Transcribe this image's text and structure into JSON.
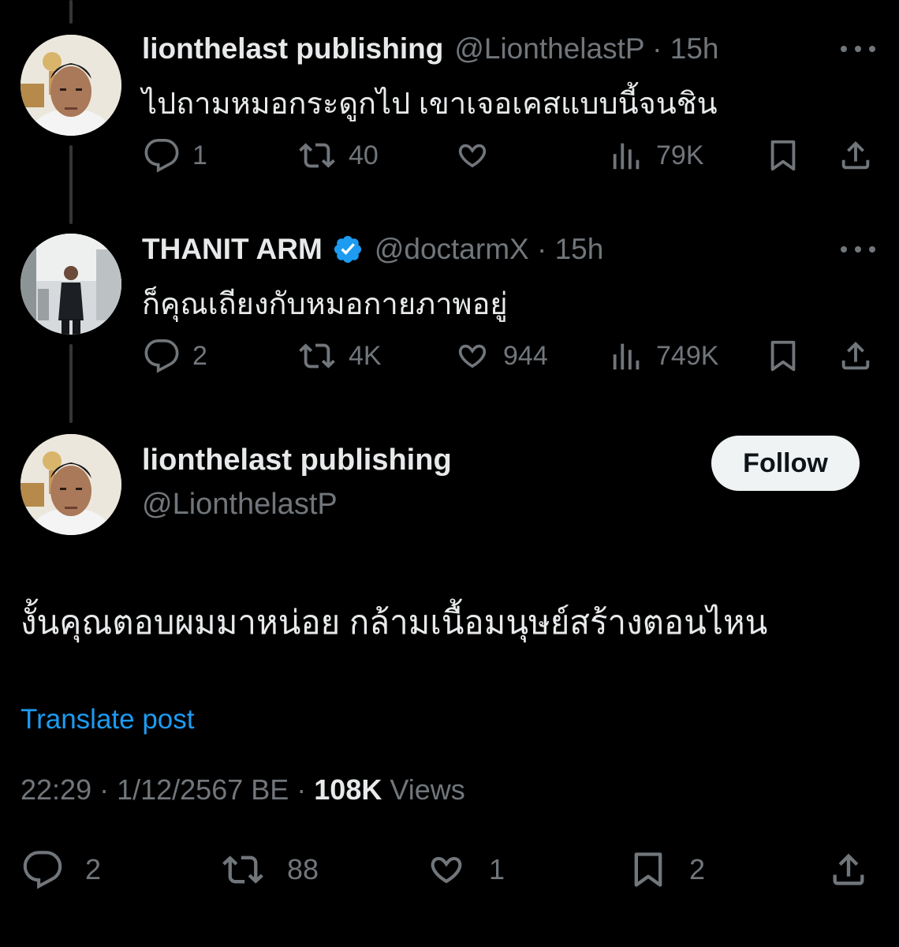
{
  "colors": {
    "background": "#000000",
    "primary_text": "#e7e9ea",
    "secondary_text": "#71767b",
    "link": "#1d9bf0",
    "verified": "#1d9bf0",
    "follow_bg": "#eff3f4"
  },
  "replies": [
    {
      "display_name": "lionthelast publishing",
      "handle": "@LionthelastP",
      "time": "15h",
      "verified": false,
      "text": "ไปถามหมอกระดูกไป เขาเจอเคสแบบนี้จนชิน",
      "actions": {
        "reply_icon": "reply-icon",
        "reply_count": "1",
        "repost_icon": "repost-icon",
        "repost_count": "40",
        "like_icon": "heart-icon",
        "like_count": "",
        "views_icon": "views-icon",
        "views_count": "79K",
        "bookmark_icon": "bookmark-icon",
        "share_icon": "share-icon"
      }
    },
    {
      "display_name": "THANIT ARM",
      "handle": "@doctarmX",
      "time": "15h",
      "verified": true,
      "text": "ก็คุณเถียงกับหมอกายภาพอยู่",
      "actions": {
        "reply_icon": "reply-icon",
        "reply_count": "2",
        "repost_icon": "repost-icon",
        "repost_count": "4K",
        "like_icon": "heart-icon",
        "like_count": "944",
        "views_icon": "views-icon",
        "views_count": "749K",
        "bookmark_icon": "bookmark-icon",
        "share_icon": "share-icon"
      }
    }
  ],
  "main_post": {
    "display_name": "lionthelast publishing",
    "handle": "@LionthelastP",
    "follow_label": "Follow",
    "text": "งั้นคุณตอบผมมาหน่อย กล้ามเนื้อมนุษย์สร้างตอนไหน",
    "translate_label": "Translate post",
    "time": "22:29",
    "date": "1/12/2567 BE",
    "views_count": "108K",
    "views_label": "Views",
    "actions": {
      "reply_count": "2",
      "repost_count": "88",
      "like_count": "1",
      "bookmark_count": "2"
    }
  }
}
